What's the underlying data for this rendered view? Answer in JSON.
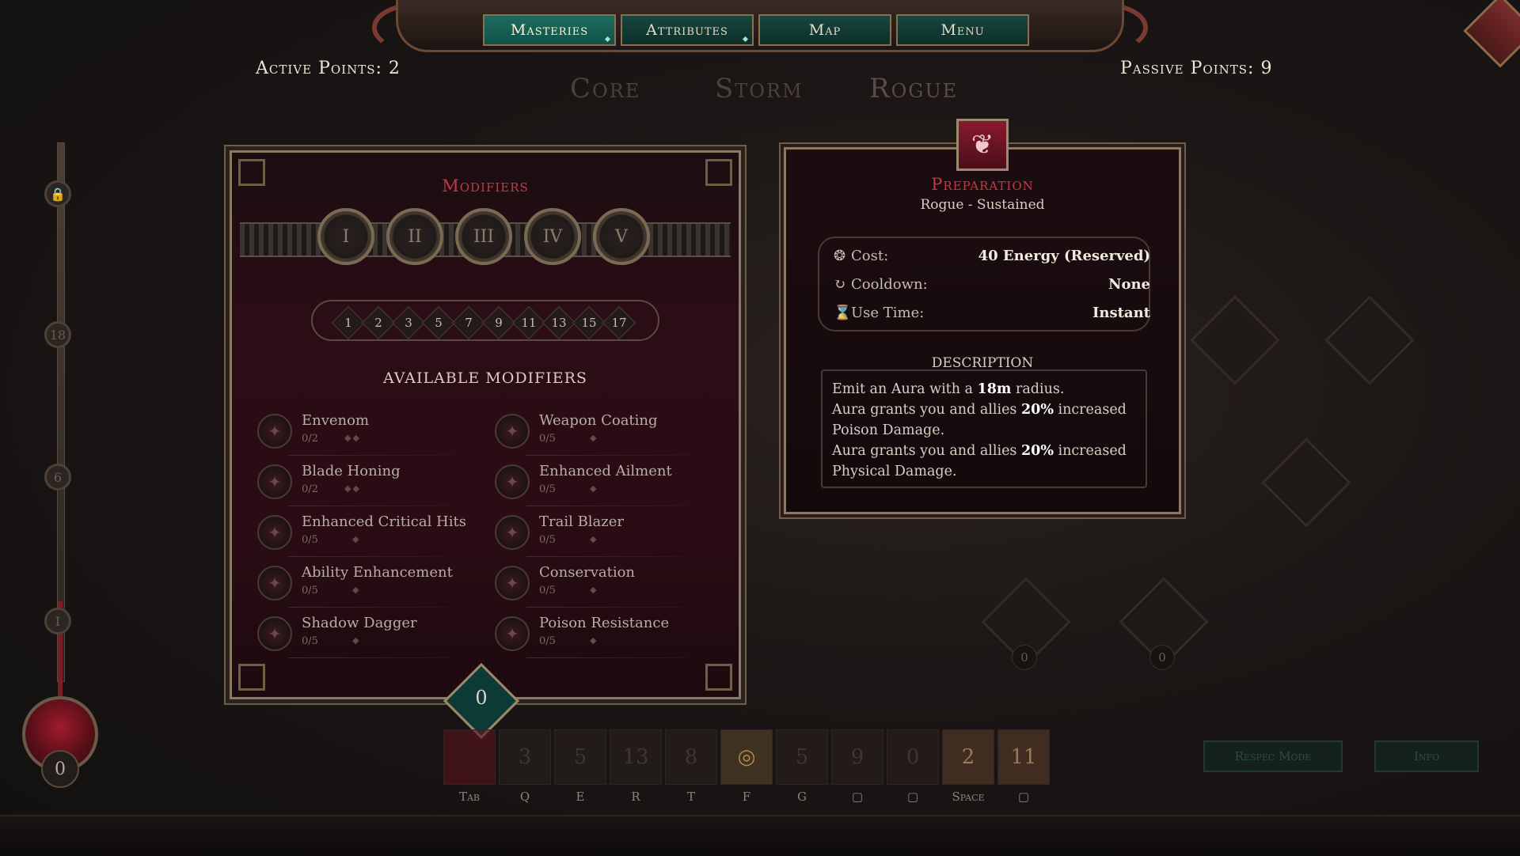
{
  "nav": {
    "tabs": [
      "Masteries",
      "Attributes",
      "Map",
      "Menu"
    ],
    "active": "Masteries"
  },
  "active_points": "Active Points: 2",
  "passive_points": "Passive Points: 9",
  "tree_tabs": [
    "Core",
    "Storm",
    "Rogue"
  ],
  "left_slider": {
    "markers": [
      "18",
      "6",
      "I"
    ],
    "orb_count": "0"
  },
  "modifiers": {
    "title": "Modifiers",
    "tiers": [
      "I",
      "II",
      "III",
      "IV",
      "V"
    ],
    "levels": [
      "1",
      "2",
      "3",
      "5",
      "7",
      "9",
      "11",
      "13",
      "15",
      "17"
    ],
    "available_title": "AVAILABLE MODIFIERS",
    "items": [
      {
        "name": "Envenom",
        "count": "0/2"
      },
      {
        "name": "Weapon Coating",
        "count": "0/5"
      },
      {
        "name": "Blade Honing",
        "count": "0/2"
      },
      {
        "name": "Enhanced Ailment",
        "count": "0/5"
      },
      {
        "name": "Enhanced Critical Hits",
        "count": "0/5"
      },
      {
        "name": "Trail Blazer",
        "count": "0/5"
      },
      {
        "name": "Ability Enhancement",
        "count": "0/5"
      },
      {
        "name": "Conservation",
        "count": "0/5"
      },
      {
        "name": "Shadow Dagger",
        "count": "0/5"
      },
      {
        "name": "Poison Resistance",
        "count": "0/5"
      }
    ],
    "counter": "0"
  },
  "skill": {
    "name": "Preparation",
    "subtitle": "Rogue - Sustained",
    "stats": [
      {
        "label": "Cost:",
        "value": "40 Energy (Reserved)",
        "icon": "flame-icon"
      },
      {
        "label": "Cooldown:",
        "value": "None",
        "icon": "cooldown-icon"
      },
      {
        "label": "Use Time:",
        "value": "Instant",
        "icon": "hourglass-icon"
      }
    ],
    "description_title": "DESCRIPTION",
    "description": {
      "l1a": "Emit an Aura with a ",
      "l1b": "18m",
      "l1c": " radius.",
      "l2a": "Aura grants you and allies ",
      "l2b": "20%",
      "l2c": " increased Poison Damage.",
      "l3a": "Aura grants you and allies ",
      "l3b": "20%",
      "l3c": " increased Physical Damage."
    }
  },
  "bg_nodes": [
    "0",
    "0"
  ],
  "hotbar": {
    "keys": [
      "Tab",
      "Q",
      "E",
      "R",
      "T",
      "F",
      "G",
      "",
      "",
      "Space",
      ""
    ],
    "slot_numbers": [
      "",
      "3",
      "5",
      "13",
      "8",
      "",
      "5",
      "9",
      "0",
      "2",
      "11"
    ]
  },
  "buttons": {
    "respec": "Respec Mode",
    "info": "Info"
  },
  "colors": {
    "accent_red": "#c13a48",
    "teal_tab": "#1c6b5e",
    "gold_border": "#8a7a60"
  }
}
